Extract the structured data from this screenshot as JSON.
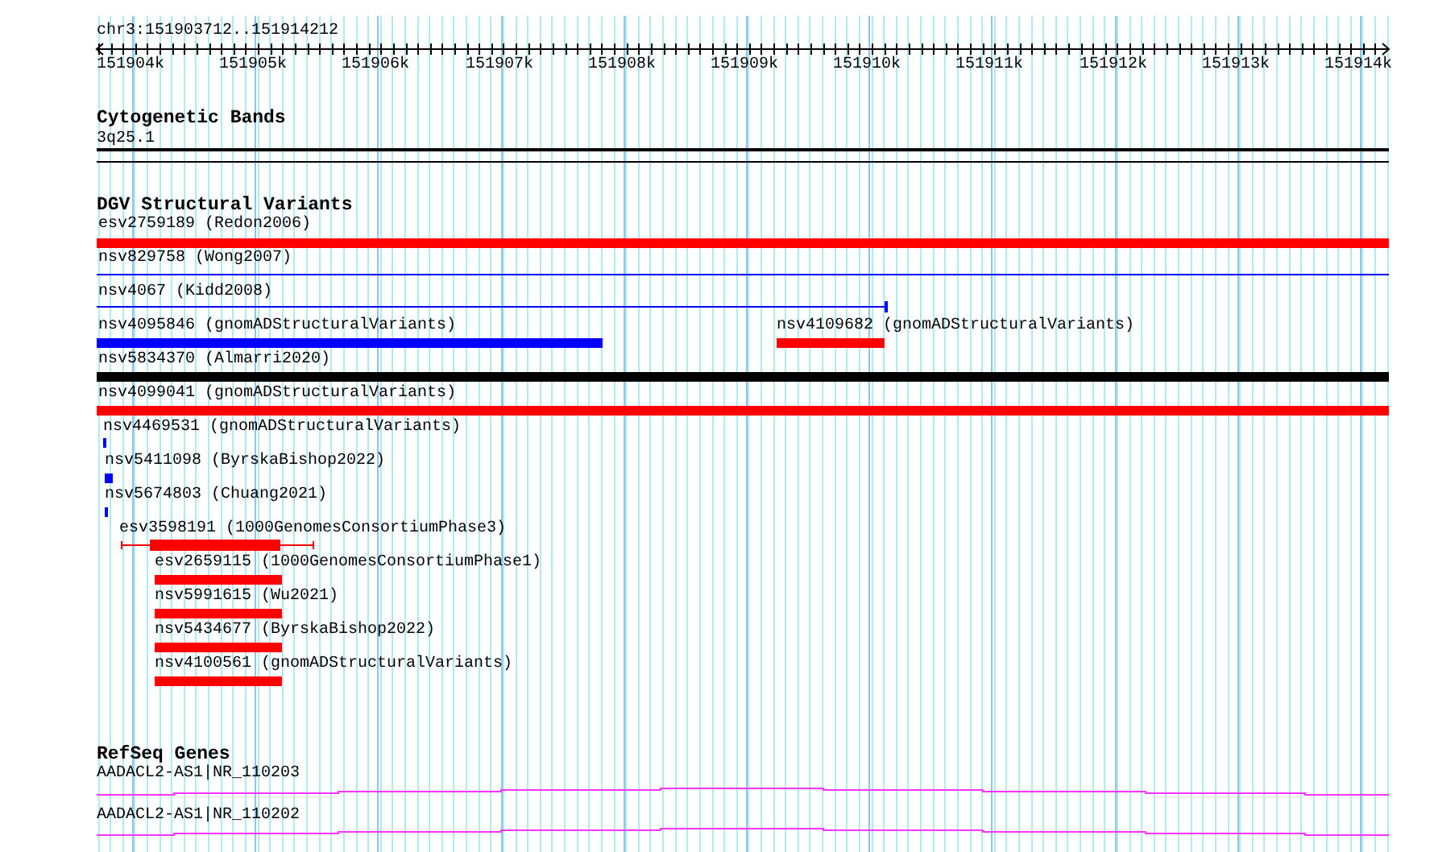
{
  "location": "chr3:151903712..151914212",
  "ruler": {
    "ticks": [
      "151904k",
      "151905k",
      "151906k",
      "151907k",
      "151908k",
      "151909k",
      "151910k",
      "151911k",
      "151912k",
      "151913k",
      "151914k"
    ]
  },
  "tracks": [
    {
      "title": "Cytogenetic Bands",
      "kind": "bands",
      "features": [
        {
          "label": "3q25.1"
        }
      ]
    },
    {
      "title": "DGV Structural Variants",
      "kind": "variants",
      "features": [
        {
          "label": "esv2759189 (Redon2006)",
          "color": "#ff0000"
        },
        {
          "label": "nsv829758 (Wong2007)",
          "color": "#0000ff"
        },
        {
          "label": "nsv4067 (Kidd2008)",
          "color": "#0000ff"
        },
        {
          "label": "nsv4095846 (gnomADStructuralVariants)",
          "color": "#0000ff"
        },
        {
          "label": "nsv4109682 (gnomADStructuralVariants)",
          "color": "#ff0000"
        },
        {
          "label": "nsv5834370 (Almarri2020)",
          "color": "#000000"
        },
        {
          "label": "nsv4099041 (gnomADStructuralVariants)",
          "color": "#ff0000"
        },
        {
          "label": "nsv4469531 (gnomADStructuralVariants)",
          "color": "#0000ff"
        },
        {
          "label": "nsv5411098 (ByrskaBishop2022)",
          "color": "#0000ff"
        },
        {
          "label": "nsv5674803 (Chuang2021)",
          "color": "#0000ff"
        },
        {
          "label": "esv3598191 (1000GenomesConsortiumPhase3)",
          "color": "#ff0000"
        },
        {
          "label": "esv2659115 (1000GenomesConsortiumPhase1)",
          "color": "#ff0000"
        },
        {
          "label": "nsv5991615 (Wu2021)",
          "color": "#ff0000"
        },
        {
          "label": "nsv5434677 (ByrskaBishop2022)",
          "color": "#ff0000"
        },
        {
          "label": "nsv4100561 (gnomADStructuralVariants)",
          "color": "#ff0000"
        }
      ]
    },
    {
      "title": "RefSeq Genes",
      "kind": "genes",
      "features": [
        {
          "label": "AADACL2-AS1|NR_110203"
        },
        {
          "label": "AADACL2-AS1|NR_110202"
        }
      ]
    }
  ]
}
